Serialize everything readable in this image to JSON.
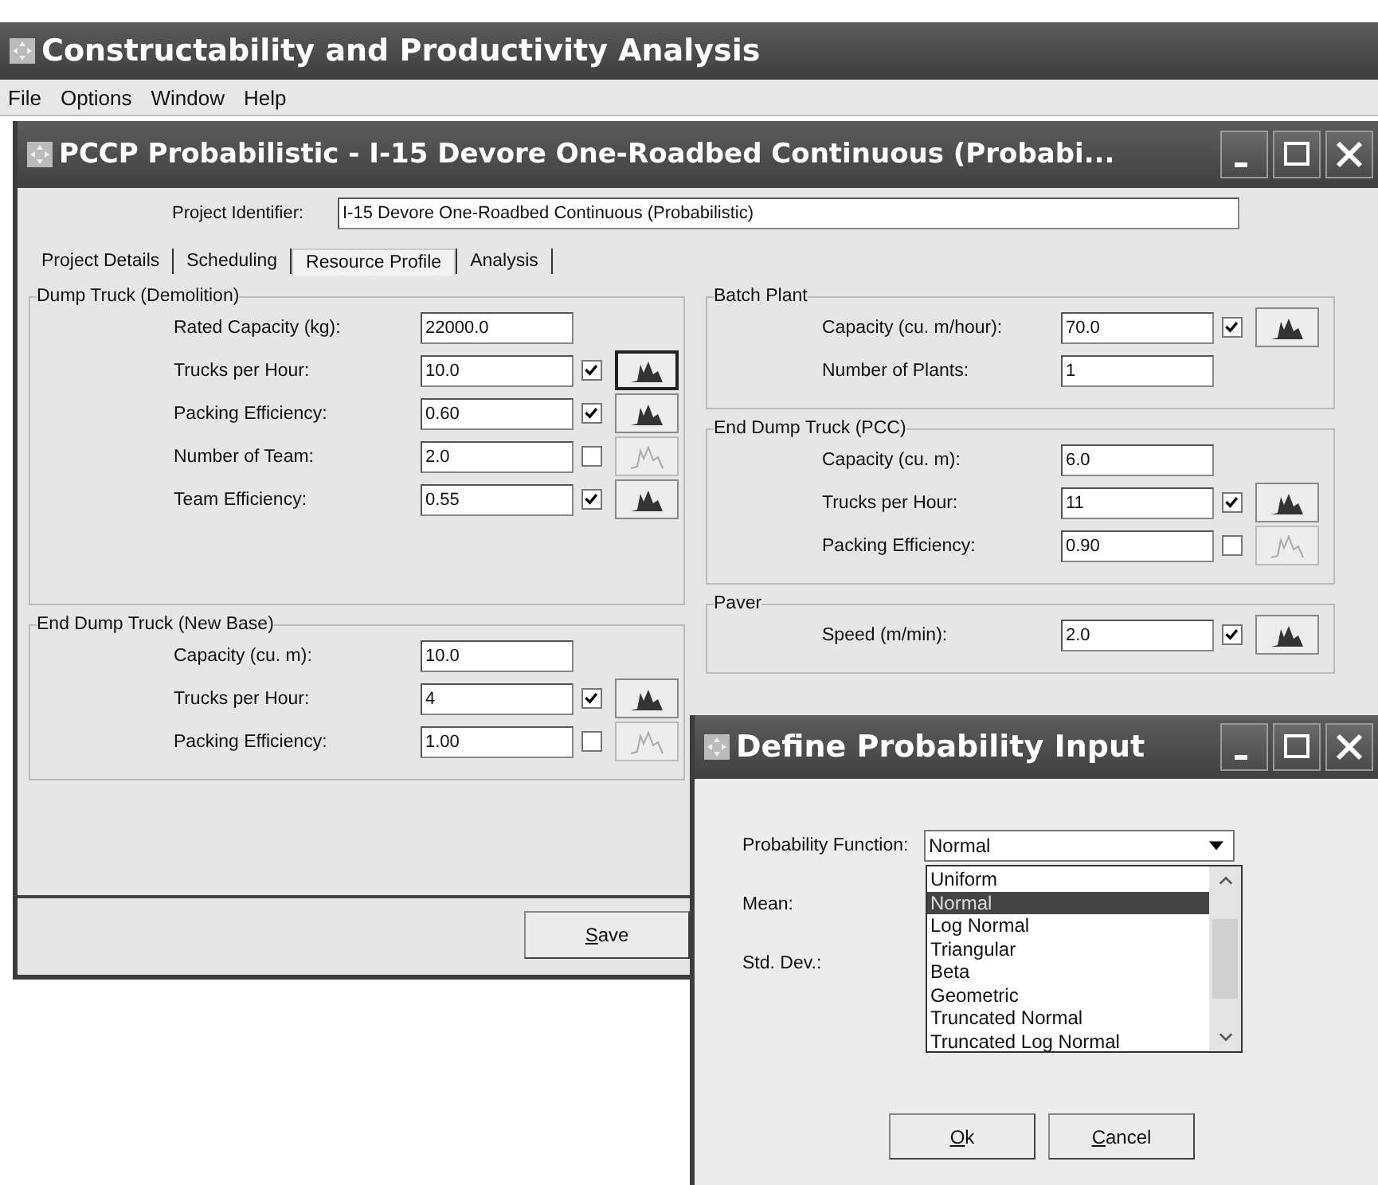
{
  "app": {
    "title": "Constructability and Productivity Analysis"
  },
  "menu": [
    "File",
    "Options",
    "Window",
    "Help"
  ],
  "document_window": {
    "title": "PCCP Probabilistic - I-15 Devore One-Roadbed Continuous (Probabi...",
    "project_identifier": {
      "label": "Project Identifier:",
      "value": "I-15 Devore One-Roadbed Continuous (Probabilistic)"
    },
    "tabs": [
      {
        "label": "Project Details",
        "selected": false
      },
      {
        "label": "Scheduling",
        "selected": false
      },
      {
        "label": "Resource Profile",
        "selected": true
      },
      {
        "label": "Analysis",
        "selected": false
      }
    ],
    "left_groups": [
      {
        "title": "Dump Truck (Demolition)",
        "fields": [
          {
            "label": "Rated Capacity (kg):",
            "value": "22000.0",
            "kind": "plain"
          },
          {
            "label": "Trucks per Hour:",
            "value": "10.0",
            "kind": "probabilistic",
            "checked": true,
            "focused": true
          },
          {
            "label": "Packing Efficiency:",
            "value": "0.60",
            "kind": "probabilistic",
            "checked": true,
            "focused": false
          },
          {
            "label": "Number of Team:",
            "value": "2.0",
            "kind": "probabilistic",
            "checked": false,
            "focused": false
          },
          {
            "label": "Team Efficiency:",
            "value": "0.55",
            "kind": "probabilistic",
            "checked": true,
            "focused": false
          }
        ]
      },
      {
        "title": "End Dump Truck (New Base)",
        "fields": [
          {
            "label": "Capacity (cu. m):",
            "value": "10.0",
            "kind": "plain"
          },
          {
            "label": "Trucks per Hour:",
            "value": "4",
            "kind": "probabilistic",
            "checked": true,
            "focused": false
          },
          {
            "label": "Packing Efficiency:",
            "value": "1.00",
            "kind": "probabilistic",
            "checked": false,
            "focused": false
          }
        ]
      }
    ],
    "right_groups": [
      {
        "title": "Batch Plant",
        "fields": [
          {
            "label": "Capacity (cu. m/hour):",
            "value": "70.0",
            "kind": "probabilistic",
            "checked": true,
            "focused": false
          },
          {
            "label": "Number of Plants:",
            "value": "1",
            "kind": "plain"
          }
        ]
      },
      {
        "title": "End Dump Truck (PCC)",
        "fields": [
          {
            "label": "Capacity (cu. m):",
            "value": "6.0",
            "kind": "plain"
          },
          {
            "label": "Trucks per Hour:",
            "value": "11",
            "kind": "probabilistic",
            "checked": true,
            "focused": false
          },
          {
            "label": "Packing Efficiency:",
            "value": "0.90",
            "kind": "probabilistic",
            "checked": false,
            "focused": false
          }
        ]
      },
      {
        "title": "Paver",
        "fields": [
          {
            "label": "Speed (m/min):",
            "value": "2.0",
            "kind": "probabilistic",
            "checked": true,
            "focused": false
          }
        ]
      }
    ],
    "save_button": "Save"
  },
  "dialog": {
    "title": "Define Probability Input",
    "function_label": "Probability Function:",
    "function_value": "Normal",
    "options": [
      {
        "label": "Uniform",
        "selected": false
      },
      {
        "label": "Normal",
        "selected": true
      },
      {
        "label": "Log Normal",
        "selected": false
      },
      {
        "label": "Triangular",
        "selected": false
      },
      {
        "label": "Beta",
        "selected": false
      },
      {
        "label": "Geometric",
        "selected": false
      },
      {
        "label": "Truncated Normal",
        "selected": false
      },
      {
        "label": "Truncated Log Normal",
        "selected": false
      }
    ],
    "mean_label": "Mean:",
    "std_dev_label": "Std. Dev.:",
    "buttons": [
      "Ok",
      "Cancel"
    ]
  }
}
